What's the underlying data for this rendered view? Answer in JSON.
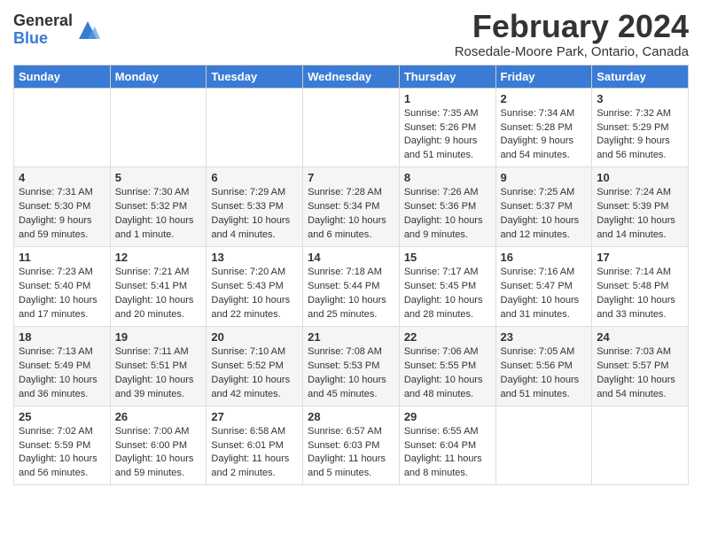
{
  "header": {
    "logo_general": "General",
    "logo_blue": "Blue",
    "title": "February 2024",
    "subtitle": "Rosedale-Moore Park, Ontario, Canada"
  },
  "calendar": {
    "days_of_week": [
      "Sunday",
      "Monday",
      "Tuesday",
      "Wednesday",
      "Thursday",
      "Friday",
      "Saturday"
    ],
    "weeks": [
      [
        {
          "num": "",
          "info": ""
        },
        {
          "num": "",
          "info": ""
        },
        {
          "num": "",
          "info": ""
        },
        {
          "num": "",
          "info": ""
        },
        {
          "num": "1",
          "info": "Sunrise: 7:35 AM\nSunset: 5:26 PM\nDaylight: 9 hours and 51 minutes."
        },
        {
          "num": "2",
          "info": "Sunrise: 7:34 AM\nSunset: 5:28 PM\nDaylight: 9 hours and 54 minutes."
        },
        {
          "num": "3",
          "info": "Sunrise: 7:32 AM\nSunset: 5:29 PM\nDaylight: 9 hours and 56 minutes."
        }
      ],
      [
        {
          "num": "4",
          "info": "Sunrise: 7:31 AM\nSunset: 5:30 PM\nDaylight: 9 hours and 59 minutes."
        },
        {
          "num": "5",
          "info": "Sunrise: 7:30 AM\nSunset: 5:32 PM\nDaylight: 10 hours and 1 minute."
        },
        {
          "num": "6",
          "info": "Sunrise: 7:29 AM\nSunset: 5:33 PM\nDaylight: 10 hours and 4 minutes."
        },
        {
          "num": "7",
          "info": "Sunrise: 7:28 AM\nSunset: 5:34 PM\nDaylight: 10 hours and 6 minutes."
        },
        {
          "num": "8",
          "info": "Sunrise: 7:26 AM\nSunset: 5:36 PM\nDaylight: 10 hours and 9 minutes."
        },
        {
          "num": "9",
          "info": "Sunrise: 7:25 AM\nSunset: 5:37 PM\nDaylight: 10 hours and 12 minutes."
        },
        {
          "num": "10",
          "info": "Sunrise: 7:24 AM\nSunset: 5:39 PM\nDaylight: 10 hours and 14 minutes."
        }
      ],
      [
        {
          "num": "11",
          "info": "Sunrise: 7:23 AM\nSunset: 5:40 PM\nDaylight: 10 hours and 17 minutes."
        },
        {
          "num": "12",
          "info": "Sunrise: 7:21 AM\nSunset: 5:41 PM\nDaylight: 10 hours and 20 minutes."
        },
        {
          "num": "13",
          "info": "Sunrise: 7:20 AM\nSunset: 5:43 PM\nDaylight: 10 hours and 22 minutes."
        },
        {
          "num": "14",
          "info": "Sunrise: 7:18 AM\nSunset: 5:44 PM\nDaylight: 10 hours and 25 minutes."
        },
        {
          "num": "15",
          "info": "Sunrise: 7:17 AM\nSunset: 5:45 PM\nDaylight: 10 hours and 28 minutes."
        },
        {
          "num": "16",
          "info": "Sunrise: 7:16 AM\nSunset: 5:47 PM\nDaylight: 10 hours and 31 minutes."
        },
        {
          "num": "17",
          "info": "Sunrise: 7:14 AM\nSunset: 5:48 PM\nDaylight: 10 hours and 33 minutes."
        }
      ],
      [
        {
          "num": "18",
          "info": "Sunrise: 7:13 AM\nSunset: 5:49 PM\nDaylight: 10 hours and 36 minutes."
        },
        {
          "num": "19",
          "info": "Sunrise: 7:11 AM\nSunset: 5:51 PM\nDaylight: 10 hours and 39 minutes."
        },
        {
          "num": "20",
          "info": "Sunrise: 7:10 AM\nSunset: 5:52 PM\nDaylight: 10 hours and 42 minutes."
        },
        {
          "num": "21",
          "info": "Sunrise: 7:08 AM\nSunset: 5:53 PM\nDaylight: 10 hours and 45 minutes."
        },
        {
          "num": "22",
          "info": "Sunrise: 7:06 AM\nSunset: 5:55 PM\nDaylight: 10 hours and 48 minutes."
        },
        {
          "num": "23",
          "info": "Sunrise: 7:05 AM\nSunset: 5:56 PM\nDaylight: 10 hours and 51 minutes."
        },
        {
          "num": "24",
          "info": "Sunrise: 7:03 AM\nSunset: 5:57 PM\nDaylight: 10 hours and 54 minutes."
        }
      ],
      [
        {
          "num": "25",
          "info": "Sunrise: 7:02 AM\nSunset: 5:59 PM\nDaylight: 10 hours and 56 minutes."
        },
        {
          "num": "26",
          "info": "Sunrise: 7:00 AM\nSunset: 6:00 PM\nDaylight: 10 hours and 59 minutes."
        },
        {
          "num": "27",
          "info": "Sunrise: 6:58 AM\nSunset: 6:01 PM\nDaylight: 11 hours and 2 minutes."
        },
        {
          "num": "28",
          "info": "Sunrise: 6:57 AM\nSunset: 6:03 PM\nDaylight: 11 hours and 5 minutes."
        },
        {
          "num": "29",
          "info": "Sunrise: 6:55 AM\nSunset: 6:04 PM\nDaylight: 11 hours and 8 minutes."
        },
        {
          "num": "",
          "info": ""
        },
        {
          "num": "",
          "info": ""
        }
      ]
    ]
  }
}
